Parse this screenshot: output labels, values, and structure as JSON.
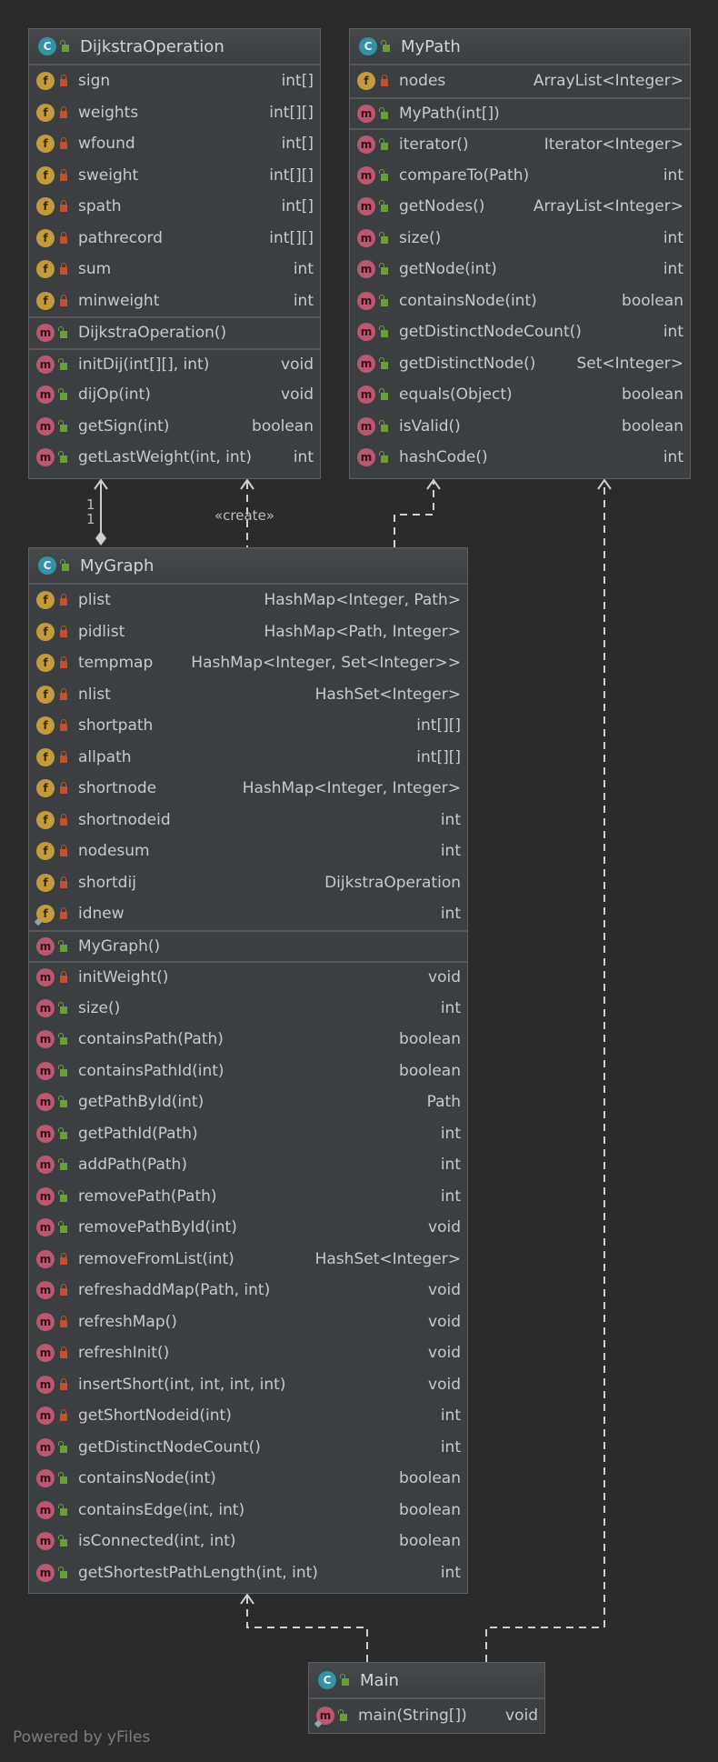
{
  "classes": {
    "dijkstra": {
      "name": "DijkstraOperation",
      "fields": [
        {
          "name": "sign",
          "type": "int[]"
        },
        {
          "name": "weights",
          "type": "int[][]"
        },
        {
          "name": "wfound",
          "type": "int[]"
        },
        {
          "name": "sweight",
          "type": "int[][]"
        },
        {
          "name": "spath",
          "type": "int[]"
        },
        {
          "name": "pathrecord",
          "type": "int[][]"
        },
        {
          "name": "sum",
          "type": "int"
        },
        {
          "name": "minweight",
          "type": "int"
        }
      ],
      "constructors": [
        {
          "name": "DijkstraOperation()",
          "type": ""
        }
      ],
      "methods": [
        {
          "name": "initDij(int[][], int)",
          "type": "void"
        },
        {
          "name": "dijOp(int)",
          "type": "void"
        },
        {
          "name": "getSign(int)",
          "type": "boolean"
        },
        {
          "name": "getLastWeight(int, int)",
          "type": "int"
        }
      ]
    },
    "mypath": {
      "name": "MyPath",
      "fields": [
        {
          "name": "nodes",
          "type": "ArrayList<Integer>"
        }
      ],
      "constructors": [
        {
          "name": "MyPath(int[])",
          "type": ""
        }
      ],
      "methods": [
        {
          "name": "iterator()",
          "type": "Iterator<Integer>"
        },
        {
          "name": "compareTo(Path)",
          "type": "int"
        },
        {
          "name": "getNodes()",
          "type": "ArrayList<Integer>"
        },
        {
          "name": "size()",
          "type": "int"
        },
        {
          "name": "getNode(int)",
          "type": "int"
        },
        {
          "name": "containsNode(int)",
          "type": "boolean"
        },
        {
          "name": "getDistinctNodeCount()",
          "type": "int"
        },
        {
          "name": "getDistinctNode()",
          "type": "Set<Integer>"
        },
        {
          "name": "equals(Object)",
          "type": "boolean"
        },
        {
          "name": "isValid()",
          "type": "boolean"
        },
        {
          "name": "hashCode()",
          "type": "int"
        }
      ]
    },
    "mygraph": {
      "name": "MyGraph",
      "fields": [
        {
          "name": "plist",
          "type": "HashMap<Integer, Path>"
        },
        {
          "name": "pidlist",
          "type": "HashMap<Path, Integer>"
        },
        {
          "name": "tempmap",
          "type": "HashMap<Integer, Set<Integer>>"
        },
        {
          "name": "nlist",
          "type": "HashSet<Integer>"
        },
        {
          "name": "shortpath",
          "type": "int[][]"
        },
        {
          "name": "allpath",
          "type": "int[][]"
        },
        {
          "name": "shortnode",
          "type": "HashMap<Integer, Integer>"
        },
        {
          "name": "shortnodeid",
          "type": "int"
        },
        {
          "name": "nodesum",
          "type": "int"
        },
        {
          "name": "shortdij",
          "type": "DijkstraOperation"
        },
        {
          "name": "idnew",
          "type": "int"
        }
      ],
      "constructors": [
        {
          "name": "MyGraph()",
          "type": ""
        }
      ],
      "methods": [
        {
          "name": "initWeight()",
          "type": "void"
        },
        {
          "name": "size()",
          "type": "int"
        },
        {
          "name": "containsPath(Path)",
          "type": "boolean"
        },
        {
          "name": "containsPathId(int)",
          "type": "boolean"
        },
        {
          "name": "getPathById(int)",
          "type": "Path"
        },
        {
          "name": "getPathId(Path)",
          "type": "int"
        },
        {
          "name": "addPath(Path)",
          "type": "int"
        },
        {
          "name": "removePath(Path)",
          "type": "int"
        },
        {
          "name": "removePathById(int)",
          "type": "void"
        },
        {
          "name": "removeFromList(int)",
          "type": "HashSet<Integer>"
        },
        {
          "name": "refreshaddMap(Path, int)",
          "type": "void"
        },
        {
          "name": "refreshMap()",
          "type": "void"
        },
        {
          "name": "refreshInit()",
          "type": "void"
        },
        {
          "name": "insertShort(int, int, int, int)",
          "type": "void"
        },
        {
          "name": "getShortNodeid(int)",
          "type": "int"
        },
        {
          "name": "getDistinctNodeCount()",
          "type": "int"
        },
        {
          "name": "containsNode(int)",
          "type": "boolean"
        },
        {
          "name": "containsEdge(int, int)",
          "type": "boolean"
        },
        {
          "name": "isConnected(int, int)",
          "type": "boolean"
        },
        {
          "name": "getShortestPathLength(int, int)",
          "type": "int"
        }
      ]
    },
    "main": {
      "name": "Main",
      "fields": [],
      "constructors": [],
      "methods": [
        {
          "name": "main(String[])",
          "type": "void"
        }
      ]
    }
  },
  "labels": {
    "multiplicity_top": "1",
    "multiplicity_bottom": "1",
    "create": "«create»"
  },
  "footer": "Powered by yFiles",
  "icons": {
    "class": "C",
    "field": "f",
    "method": "m"
  },
  "colors": {
    "background": "#2b2b2b",
    "class_fill": "#3c3f41",
    "class_icon": "#3591a5",
    "field_icon": "#c39a3c",
    "method_icon": "#b95870",
    "private": "#c4502f",
    "public": "#6b9e3a"
  }
}
